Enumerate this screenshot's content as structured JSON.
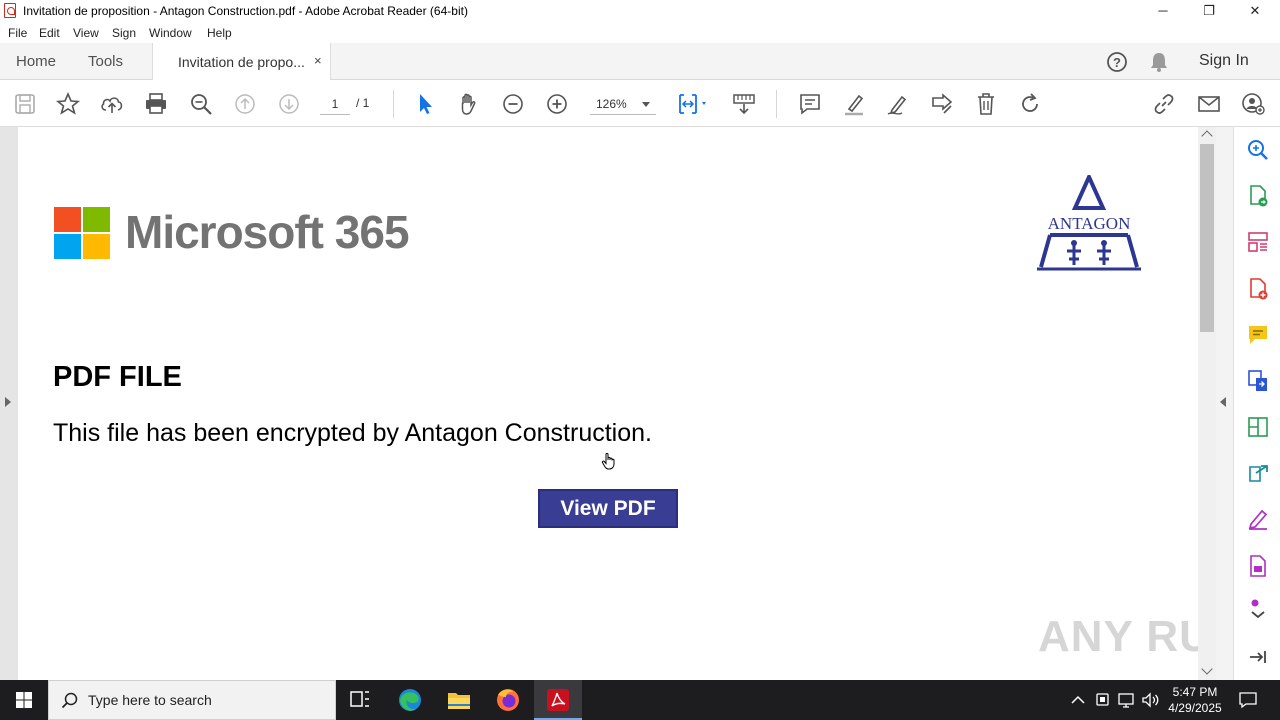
{
  "window": {
    "title": "Invitation de proposition - Antagon Construction.pdf - Adobe Acrobat Reader (64-bit)",
    "minimize": "─",
    "maximize": "❐",
    "close": "✕"
  },
  "menu": [
    "File",
    "Edit",
    "View",
    "Sign",
    "Window",
    "Help"
  ],
  "tabs": {
    "home": "Home",
    "tools": "Tools",
    "document": "Invitation de propo...",
    "close": "×",
    "signin": "Sign In"
  },
  "toolbar": {
    "page_current": "1",
    "page_total": "/ 1",
    "zoom": "126%"
  },
  "document": {
    "brand_text": "Microsoft 365",
    "brand_colors": [
      "#f25022",
      "#7fba00",
      "#00a4ef",
      "#ffb900"
    ],
    "company_logo_text": "ANTAGON",
    "heading": "PDF FILE",
    "message": "This file has been encrypted by Antagon Construction.",
    "button_label": "View PDF",
    "button_color": "#3a3d94"
  },
  "watermark": "ANY RUN",
  "taskbar": {
    "search_placeholder": "Type here to search",
    "time": "5:47 PM",
    "date": "4/29/2025"
  },
  "icons": {
    "toolbar": [
      "save-icon",
      "bookmark-star-icon",
      "upload-icon",
      "print-icon",
      "zoom-search-icon",
      "prev-page-icon",
      "next-page-icon",
      "select-pointer-icon",
      "hand-icon",
      "zoom-out-icon",
      "zoom-in-icon",
      "page-fit-icon",
      "scroll-mode-icon",
      "comment-icon",
      "highlight-icon",
      "draw-icon",
      "edit-sign-icon",
      "delete-icon",
      "rotate-icon",
      "share-link-icon",
      "email-icon",
      "add-user-icon"
    ],
    "right_pane": [
      "search-zoom-icon",
      "export-pdf-icon",
      "organize-pages-icon",
      "create-pdf-icon",
      "comment-icon",
      "combine-files-icon",
      "compress-icon",
      "send-for-review-icon",
      "fill-sign-icon",
      "edit-pdf-icon",
      "more-tools-icon"
    ]
  }
}
